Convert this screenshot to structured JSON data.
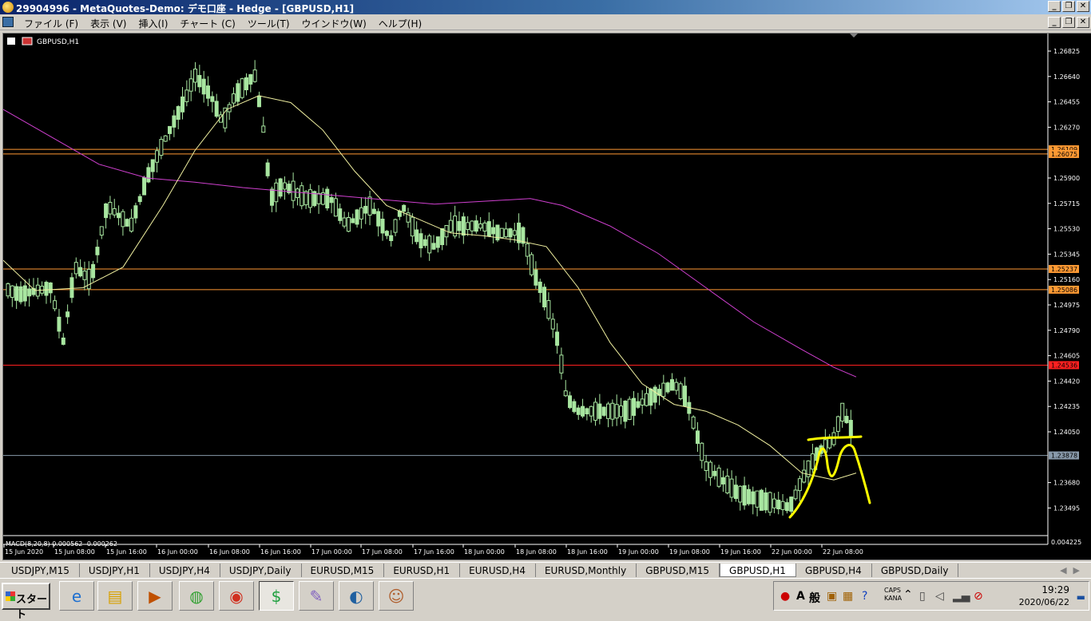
{
  "window": {
    "title": "29904996 - MetaQuotes-Demo: デモ口座 - Hedge - [GBPUSD,H1]",
    "controls": [
      "_",
      "❐",
      "✕"
    ]
  },
  "menu": {
    "items": [
      "ファイル (F)",
      "表示 (V)",
      "挿入(I)",
      "チャート (C)",
      "ツール(T)",
      "ウインドウ(W)",
      "ヘルプ(H)"
    ]
  },
  "chart": {
    "symbol_label": "GBPUSD,H1",
    "indicator_label": "MACD(8,20,8) 0.000562 -0.000262",
    "price_ticks": [
      "1.26825",
      "1.26640",
      "1.26455",
      "1.26270",
      "1.25900",
      "1.25715",
      "1.25530",
      "1.25345",
      "1.25160",
      "1.24975",
      "1.24790",
      "1.24605",
      "1.24420",
      "1.24235",
      "1.24050",
      "1.23680",
      "1.23495"
    ],
    "time_ticks": [
      "15 Jun 2020",
      "15 Jun 08:00",
      "15 Jun 16:00",
      "16 Jun 00:00",
      "16 Jun 08:00",
      "16 Jun 16:00",
      "17 Jun 00:00",
      "17 Jun 08:00",
      "17 Jun 16:00",
      "18 Jun 00:00",
      "18 Jun 08:00",
      "18 Jun 16:00",
      "19 Jun 00:00",
      "19 Jun 08:00",
      "19 Jun 16:00",
      "22 Jun 00:00",
      "22 Jun 08:00"
    ],
    "hlines": [
      {
        "price": "1.26109",
        "color": "#ff9933"
      },
      {
        "price": "1.26075",
        "color": "#ff9933"
      },
      {
        "price": "1.25237",
        "color": "#ff9933"
      },
      {
        "price": "1.25086",
        "color": "#ff9933"
      },
      {
        "price": "1.24536",
        "color": "#ff2020"
      },
      {
        "price": "1.23878",
        "color": "#8899aa"
      }
    ],
    "macd_tick": "0.004225",
    "colors": {
      "background": "#000000",
      "candle": "#a8e6a0",
      "ma_fast": "#f0f0a0",
      "ma_slow": "#d040d0",
      "drawing": "#ffff00",
      "axis_text": "#ffffff"
    }
  },
  "tabs": {
    "items": [
      "USDJPY,M15",
      "USDJPY,H1",
      "USDJPY,H4",
      "USDJPY,Daily",
      "EURUSD,M15",
      "EURUSD,H1",
      "EURUSD,H4",
      "EURUSD,Monthly",
      "GBPUSD,M15",
      "GBPUSD,H1",
      "GBPUSD,H4",
      "GBPUSD,Daily"
    ],
    "active": "GBPUSD,H1"
  },
  "taskbar": {
    "start_label": "スタート",
    "apps": [
      {
        "name": "ie-icon",
        "glyph": "e"
      },
      {
        "name": "explorer-icon",
        "glyph": "▤"
      },
      {
        "name": "media-player-icon",
        "glyph": "▶"
      },
      {
        "name": "network-globe-icon",
        "glyph": "◍"
      },
      {
        "name": "chrome-icon",
        "glyph": "◉"
      },
      {
        "name": "metatrader-icon",
        "glyph": "$"
      },
      {
        "name": "paint-icon",
        "glyph": "✎"
      },
      {
        "name": "media-center-icon",
        "glyph": "◐"
      },
      {
        "name": "photo-viewer-icon",
        "glyph": "☺"
      }
    ],
    "tray": {
      "ime_a": "A",
      "ime_mode": "般",
      "caps": "CAPS",
      "kana": "KANA",
      "time": "19:29",
      "date": "2020/06/22"
    }
  }
}
